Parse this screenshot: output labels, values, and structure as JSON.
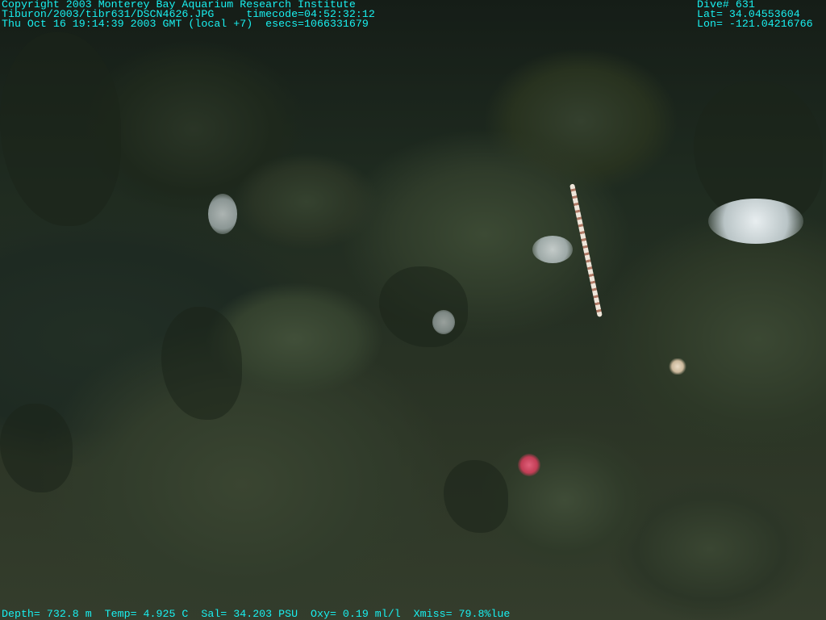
{
  "header_left": {
    "line1": "Copyright 2003 Monterey Bay Aquarium Research Institute",
    "line2": "Tiburon/2003/tibr631/DSCN4626.JPG     timecode=04:52:32:12",
    "line3": "Thu Oct 16 19:14:39 2003 GMT (local +7)  esecs=1066331679"
  },
  "header_right": {
    "dive": "Dive# 631",
    "lat": "Lat= 34.04553604",
    "lon": "Lon= -121.04216766"
  },
  "footer": {
    "line": "Depth= 732.8 m  Temp= 4.925 C  Sal= 34.203 PSU  Oxy= 0.19 ml/l  Xmiss= 79.8%lue"
  },
  "colors": {
    "overlay_text": "#19f0f0"
  }
}
